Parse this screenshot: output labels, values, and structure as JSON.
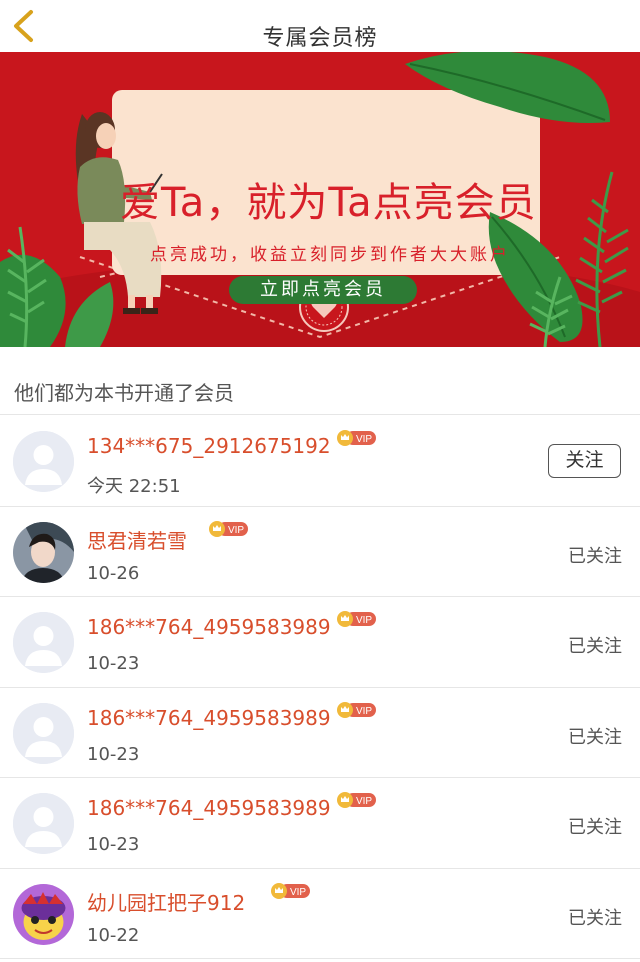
{
  "header": {
    "title": "专属会员榜",
    "back_icon": "chevron-left-icon",
    "accent_color": "#d8a21c"
  },
  "banner": {
    "title": "爱Ta，就为Ta点亮会员",
    "subtitle": "点亮成功，收益立刻同步到作者大大账户",
    "cta_label": "立即点亮会员",
    "colors": {
      "background": "#c8161d",
      "card": "#fbe3cf",
      "leaf": "#2f8a3a",
      "button": "#2d7a34"
    }
  },
  "section": {
    "title": "他们都为本书开通了会员"
  },
  "members": [
    {
      "name": "134***675_2912675192",
      "date": "今天 22:51",
      "action": "关注",
      "following": false,
      "avatar": "default-avatar-icon",
      "vip_label": "VIP"
    },
    {
      "name": "思君清若雪",
      "date": "10-26",
      "action": "已关注",
      "following": true,
      "avatar": "photo-avatar",
      "vip_label": "VIP"
    },
    {
      "name": "186***764_4959583989",
      "date": "10-23",
      "action": "已关注",
      "following": true,
      "avatar": "default-avatar-icon",
      "vip_label": "VIP"
    },
    {
      "name": "186***764_4959583989",
      "date": "10-23",
      "action": "已关注",
      "following": true,
      "avatar": "default-avatar-icon",
      "vip_label": "VIP"
    },
    {
      "name": "186***764_4959583989",
      "date": "10-23",
      "action": "已关注",
      "following": true,
      "avatar": "default-avatar-icon",
      "vip_label": "VIP"
    },
    {
      "name": "幼儿园扛把子912",
      "date": "10-22",
      "action": "已关注",
      "following": true,
      "avatar": "cartoon-avatar",
      "vip_label": "VIP"
    }
  ]
}
